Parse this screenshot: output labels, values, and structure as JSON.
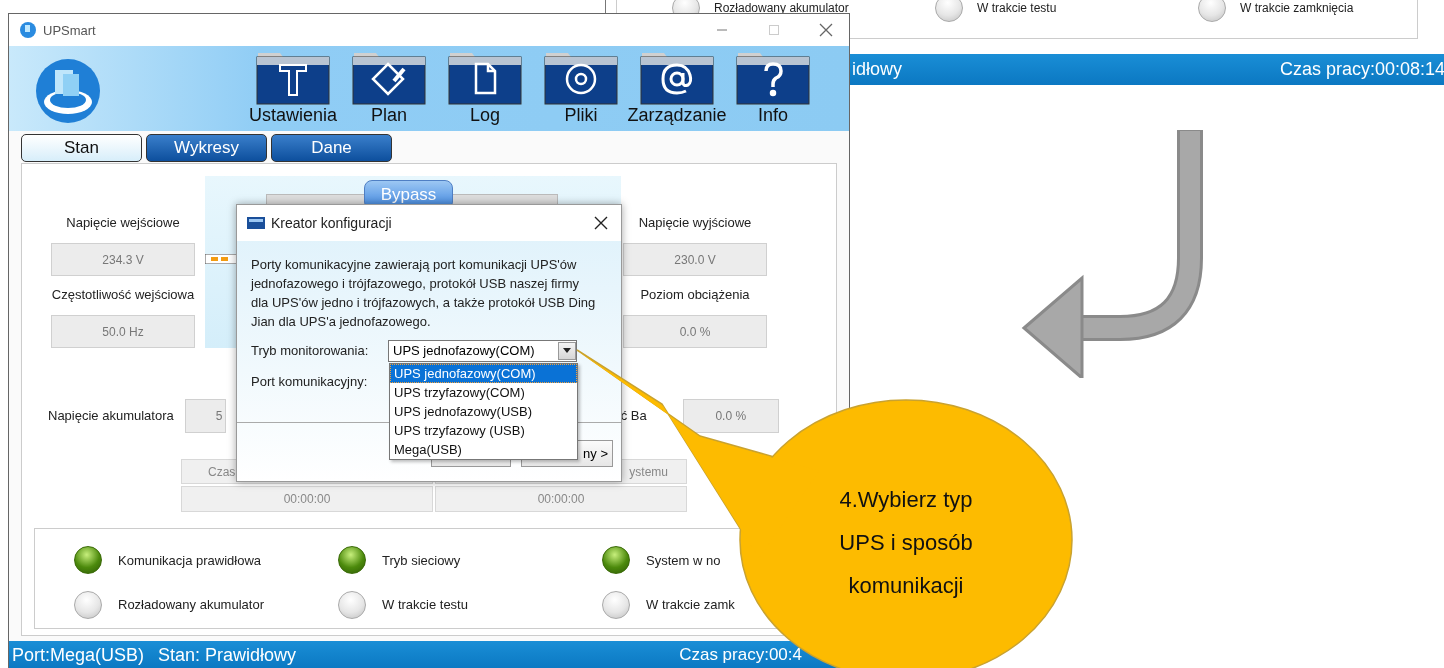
{
  "background_window": {
    "indicators": [
      {
        "label": "Rozładowany akumulator",
        "on": false
      },
      {
        "label": "W trakcie testu",
        "on": false
      },
      {
        "label": "W trakcie zamknięcia",
        "on": false
      }
    ],
    "status_bar": {
      "state": "idłowy",
      "uptime": "Czas pracy:00:08:14"
    }
  },
  "window": {
    "title": "UPSmart"
  },
  "toolbar": [
    {
      "label": "Ustawienia",
      "kind": "hammer"
    },
    {
      "label": "Plan",
      "kind": "pencil"
    },
    {
      "label": "Log",
      "kind": "document"
    },
    {
      "label": "Pliki",
      "kind": "disc"
    },
    {
      "label": "Zarządzanie",
      "kind": "at"
    },
    {
      "label": "Info",
      "kind": "question"
    }
  ],
  "tabs": [
    {
      "label": "Stan",
      "selected": true
    },
    {
      "label": "Wykresy",
      "selected": false
    },
    {
      "label": "Dane",
      "selected": false
    }
  ],
  "diagram": {
    "bypass_label": "Bypass"
  },
  "readings_left": [
    {
      "label": "Napięcie wejściowe",
      "value": "234.3 V"
    },
    {
      "label": "Częstotliwość wejściowa",
      "value": "50.0 Hz"
    }
  ],
  "readings_right": [
    {
      "label": "Napięcie wyjściowe",
      "value": "230.0 V"
    },
    {
      "label": "Poziom obciążenia",
      "value": "0.0 %"
    }
  ],
  "battery": {
    "label": "Napięcie akumulatora",
    "value": "5",
    "right_label": "ć Ba",
    "right_value": "0.0 %"
  },
  "times": [
    {
      "label": "Czas",
      "value": "00:00:00"
    },
    {
      "label": "ystemu",
      "value": "00:00:00"
    }
  ],
  "indicators": [
    {
      "label": "Komunikacja prawidłowa",
      "on": true
    },
    {
      "label": "Tryb sieciowy",
      "on": true
    },
    {
      "label": "System w no",
      "on": true
    },
    {
      "label": "Rozładowany akumulator",
      "on": false
    },
    {
      "label": "W trakcie testu",
      "on": false
    },
    {
      "label": "W trakcie zamk",
      "on": false
    }
  ],
  "status_bar": {
    "port": "Port:Mega(USB)",
    "state": "Stan: Prawidłowy",
    "uptime": "Czas pracy:00:4"
  },
  "dialog": {
    "title": "Kreator konfiguracji",
    "description": "Porty komunikacyjne zawierają port komunikacji UPS'ów jednofazowego i trójfazowego, protokół USB naszej firmy dla UPS'ów jedno i trójfazowych, a także protokół USB Ding Jian dla UPS'a jednofazowego.",
    "mode_label": "Tryb monitorowania:",
    "mode_value": "UPS jednofazowy(COM)",
    "port_label": "Port komunikacyjny:",
    "options": [
      {
        "label": "UPS jednofazowy(COM)",
        "selected": true
      },
      {
        "label": "UPS trzyfazowy(COM)",
        "selected": false
      },
      {
        "label": "UPS jednofazowy(USB)",
        "selected": false
      },
      {
        "label": "UPS trzyfazowy (USB)",
        "selected": false
      },
      {
        "label": "Mega(USB)",
        "selected": false
      }
    ],
    "next_button": "ny >"
  },
  "callout": {
    "lines": [
      "4.Wybierz typ",
      "UPS i sposób",
      "komunikacji"
    ]
  }
}
